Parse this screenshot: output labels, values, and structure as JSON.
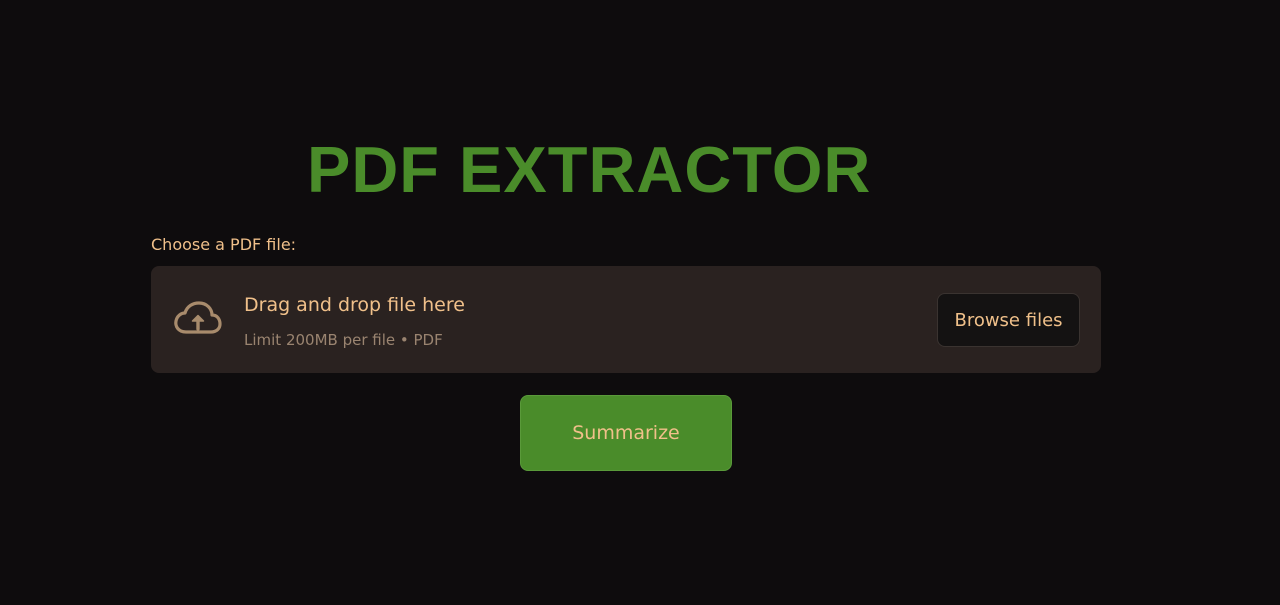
{
  "title": "PDF EXTRACTOR",
  "uploader": {
    "label": "Choose a PDF file:",
    "drop_title": "Drag and drop file here",
    "drop_subtitle": "Limit 200MB per file • PDF",
    "browse_label": "Browse files",
    "icon": "cloud-upload-icon"
  },
  "actions": {
    "summarize_label": "Summarize"
  },
  "colors": {
    "background": "#0e0c0d",
    "accent_green": "#4a8c2a",
    "text_peach": "#f0c08a",
    "dropzone_bg": "#2a2220",
    "muted_text": "#9a8470"
  }
}
